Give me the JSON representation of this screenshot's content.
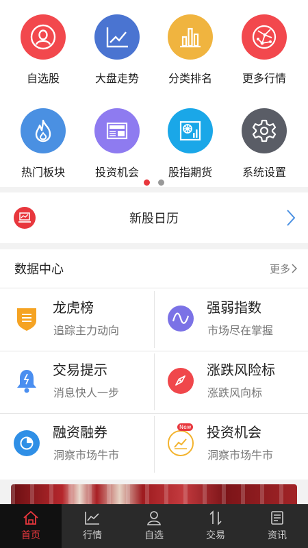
{
  "grid": {
    "items": [
      {
        "label": "自选股",
        "icon": "user-icon",
        "color": "#f2484d"
      },
      {
        "label": "大盘走势",
        "icon": "line-chart-icon",
        "color": "#4a74d1"
      },
      {
        "label": "分类排名",
        "icon": "bar-chart-icon",
        "color": "#f0b43f"
      },
      {
        "label": "更多行情",
        "icon": "network-globe-icon",
        "color": "#f2484d"
      },
      {
        "label": "热门板块",
        "icon": "flame-icon",
        "color": "#4a90e2"
      },
      {
        "label": "投资机会",
        "icon": "news-icon",
        "color": "#8e7bf0"
      },
      {
        "label": "股指期货",
        "icon": "hk-index-icon",
        "color": "#1aa7e8"
      },
      {
        "label": "系统设置",
        "icon": "gear-icon",
        "color": "#5a5d66"
      }
    ],
    "page_dots": {
      "count": 2,
      "active_index": 0
    }
  },
  "ipo": {
    "title": "新股日历",
    "icon": "laptop-chart-icon"
  },
  "data_center": {
    "title": "数据中心",
    "more_label": "更多",
    "cells": [
      {
        "title": "龙虎榜",
        "subtitle": "追踪主力动向",
        "icon": "shield-list-icon",
        "color": "#f5a323"
      },
      {
        "title": "强弱指数",
        "subtitle": "市场尽在掌握",
        "icon": "wave-icon",
        "color": "#7b72e6"
      },
      {
        "title": "交易提示",
        "subtitle": "消息快人一步",
        "icon": "bell-icon",
        "color": "#4a8ef0"
      },
      {
        "title": "涨跌风险标",
        "subtitle": "涨跌风向标",
        "icon": "compass-icon",
        "color": "#f0474b"
      },
      {
        "title": "融资融券",
        "subtitle": "洞察市场牛市",
        "icon": "pie-chart-icon",
        "color": "#2f8fe6"
      },
      {
        "title": "投资机会",
        "subtitle": "洞察市场牛市",
        "icon": "new-badge-chart-icon",
        "color": "#f3b32d",
        "badge": "New"
      }
    ]
  },
  "tabbar": {
    "tabs": [
      {
        "label": "首页",
        "icon": "home-icon",
        "active": true
      },
      {
        "label": "行情",
        "icon": "market-chart-icon",
        "active": false
      },
      {
        "label": "自选",
        "icon": "person-icon",
        "active": false
      },
      {
        "label": "交易",
        "icon": "trade-arrows-icon",
        "active": false
      },
      {
        "label": "资讯",
        "icon": "news-doc-icon",
        "active": false
      }
    ]
  },
  "colors": {
    "accent": "#e8373d",
    "tabbar_bg": "#2a2a2a"
  }
}
